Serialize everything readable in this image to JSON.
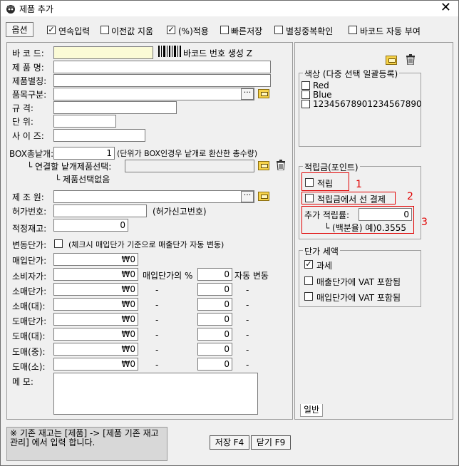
{
  "window": {
    "title": "제품 추가",
    "close_glyph": "✕"
  },
  "toolbar": {
    "options_label": "옵션",
    "checks": [
      {
        "label": "연속입력",
        "checked": true
      },
      {
        "label": "이전값 지움",
        "checked": false
      },
      {
        "label": "(%)적용",
        "checked": true
      },
      {
        "label": "빠른저장",
        "checked": false
      },
      {
        "label": "별칭중복확인",
        "checked": false
      },
      {
        "label": "바코드 자동 부여",
        "checked": false
      }
    ]
  },
  "form": {
    "barcode_label": "바 코 드:",
    "barcode_gen_label": "바코드 번호 생성 Z",
    "name_label": "제 품 명:",
    "alias_label": "제품별칭:",
    "category_label": "품목구분:",
    "spec_label": "규    격:",
    "unit_label": "단    위:",
    "size_label": "사 이 즈:",
    "box_qty_label": "BOX총낱개:",
    "box_qty_value": "1",
    "box_qty_note": "(단위가 BOX인경우 낱개로 환산한 총수량)",
    "link_label": "└ 연결할 낱개제품선택:",
    "no_product": "└ 제품선택없음",
    "maker_label": "제 조 원:",
    "permit_label": "허가번호:",
    "permit_note": "(허가신고번호)",
    "stock_label": "적정재고:",
    "stock_value": "0",
    "variable_price_label": "변동단가:",
    "variable_price_note": "(체크시 매입단가 기준으로 매출단가 자동 변동)",
    "purchase_label": "매입단가:",
    "purchase_value": "₩0",
    "consumer_label": "소비자가:",
    "consumer_value": "₩0",
    "auto_change_prefix": "매입단가의 %",
    "auto_change_value": "0",
    "auto_change_suffix": "자동 변동",
    "price_rows": [
      {
        "label": "소매단가:",
        "value": "₩0",
        "pct": "0"
      },
      {
        "label": "소매(대):",
        "value": "₩0",
        "pct": "0"
      },
      {
        "label": "도매단가:",
        "value": "₩0",
        "pct": "0"
      },
      {
        "label": "도매(대):",
        "value": "₩0",
        "pct": "0"
      },
      {
        "label": "도매(중):",
        "value": "₩0",
        "pct": "0"
      },
      {
        "label": "도매(소):",
        "value": "₩0",
        "pct": "0"
      }
    ],
    "dash": "-",
    "memo_label": "메    모:"
  },
  "right": {
    "color_group": "색상 (다중 선택 일괄등록)",
    "colors": [
      "Red",
      "Blue",
      "12345678901234567890"
    ],
    "points_group": "적립금(포인트)",
    "points_check": "적립",
    "points_pay_check": "적립금에서 선 결제",
    "extra_rate_label": "추가 적립률:",
    "extra_rate_value": "0",
    "extra_rate_hint": "└ (백분율) 예)0.3555",
    "annot1": "1",
    "annot2": "2",
    "annot3": "3",
    "tax_group": "단가 세액",
    "tax_checks": [
      {
        "label": "과세",
        "checked": true
      },
      {
        "label": "매출단가에 VAT 포함됨",
        "checked": false
      },
      {
        "label": "매입단가에 VAT 포함됨",
        "checked": false
      }
    ],
    "tab_label": "일반"
  },
  "footer": {
    "note": "※ 기존 재고는 [제품] -> [제품 기존 재고관리] 에서 입력 합니다.",
    "save_label": "저장 F4",
    "close_label": "닫기 F9"
  }
}
